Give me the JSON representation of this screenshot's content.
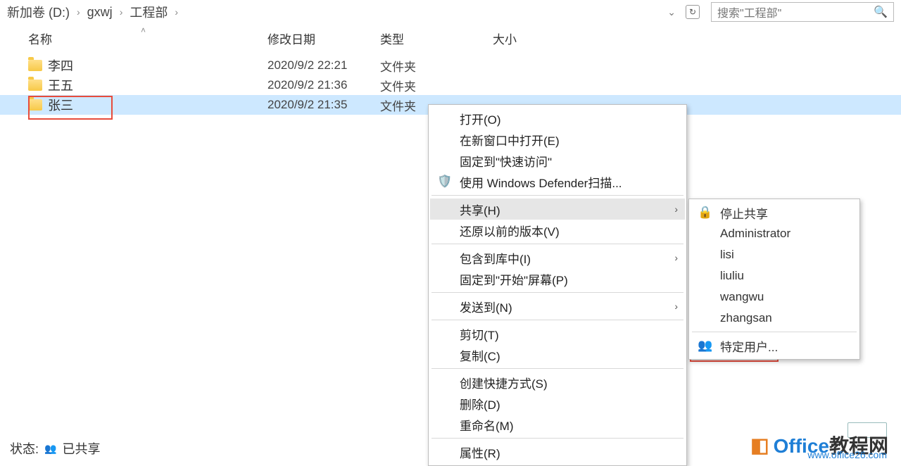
{
  "breadcrumb": {
    "a": "新加卷 (D:)",
    "b": "gxwj",
    "c": "工程部"
  },
  "search": {
    "placeholder": "搜索\"工程部\""
  },
  "columns": {
    "name": "名称",
    "date": "修改日期",
    "type": "类型",
    "size": "大小"
  },
  "rows": [
    {
      "name": "李四",
      "date": "2020/9/2 22:21",
      "type": "文件夹"
    },
    {
      "name": "王五",
      "date": "2020/9/2 21:36",
      "type": "文件夹"
    },
    {
      "name": "张三",
      "date": "2020/9/2 21:35",
      "type": "文件夹"
    }
  ],
  "ctx": {
    "open": "打开(O)",
    "open_new": "在新窗口中打开(E)",
    "pin_quick": "固定到\"快速访问\"",
    "defender": "使用 Windows Defender扫描...",
    "share": "共享(H)",
    "restore": "还原以前的版本(V)",
    "include_lib": "包含到库中(I)",
    "pin_start": "固定到\"开始\"屏幕(P)",
    "send_to": "发送到(N)",
    "cut": "剪切(T)",
    "copy": "复制(C)",
    "shortcut": "创建快捷方式(S)",
    "delete": "删除(D)",
    "rename": "重命名(M)",
    "props": "属性(R)"
  },
  "share_sub": {
    "stop": "停止共享",
    "admin": "Administrator",
    "lisi": "lisi",
    "liuliu": "liuliu",
    "wangwu": "wangwu",
    "zhangsan": "zhangsan",
    "specific": "特定用户..."
  },
  "status": {
    "label": "状态:",
    "value": "已共享"
  },
  "watermark": {
    "brand1": "Office",
    "brand2": "教程网",
    "url": "www.office26.com"
  }
}
